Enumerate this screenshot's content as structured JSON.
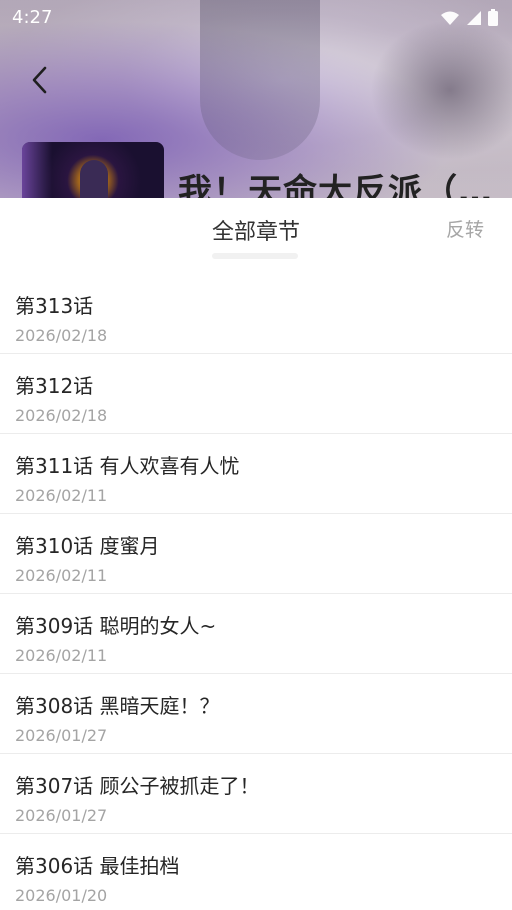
{
  "status_bar": {
    "time": "4:27"
  },
  "comic": {
    "title": "我！天命大反派（…"
  },
  "sheet": {
    "title": "全部章节",
    "reverse_label": "反转"
  },
  "chapters": [
    {
      "name": "第313话",
      "date": "2026/02/18"
    },
    {
      "name": "第312话",
      "date": "2026/02/18"
    },
    {
      "name": "第311话 有人欢喜有人忧",
      "date": "2026/02/11"
    },
    {
      "name": "第310话 度蜜月",
      "date": "2026/02/11"
    },
    {
      "name": "第309话 聪明的女人~",
      "date": "2026/02/11"
    },
    {
      "name": "第308话 黑暗天庭！？",
      "date": "2026/01/27"
    },
    {
      "name": "第307话 顾公子被抓走了！",
      "date": "2026/01/27"
    },
    {
      "name": "第306话 最佳拍档",
      "date": "2026/01/20"
    }
  ],
  "icons": {
    "back": "chevron-left-icon",
    "wifi": "wifi-icon",
    "signal": "signal-icon",
    "battery": "battery-icon"
  }
}
